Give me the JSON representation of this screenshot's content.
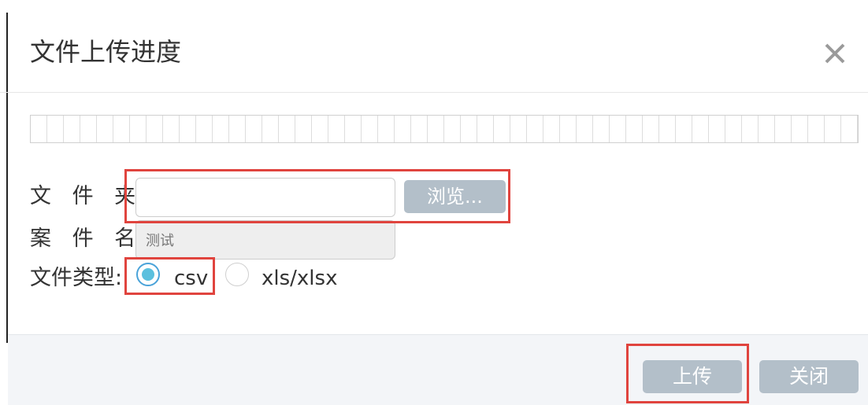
{
  "dialog": {
    "title": "文件上传进度",
    "close_icon": "close-icon"
  },
  "progress": {
    "percent": 0
  },
  "form": {
    "folder_label": "文 件 夹:",
    "folder_value": "",
    "browse_label": "浏览...",
    "case_label": "案 件 名:",
    "case_value": "测试",
    "type_label": "文件类型:",
    "type_options": [
      {
        "label": "csv",
        "selected": true
      },
      {
        "label": "xls/xlsx",
        "selected": false
      }
    ]
  },
  "footer": {
    "upload_label": "上传",
    "close_label": "关闭"
  },
  "colors": {
    "button_bg": "#b3bfc9",
    "radio_selected": "#5bc0de",
    "highlight": "#e0443e",
    "footer_bg": "#f3f5f8"
  }
}
